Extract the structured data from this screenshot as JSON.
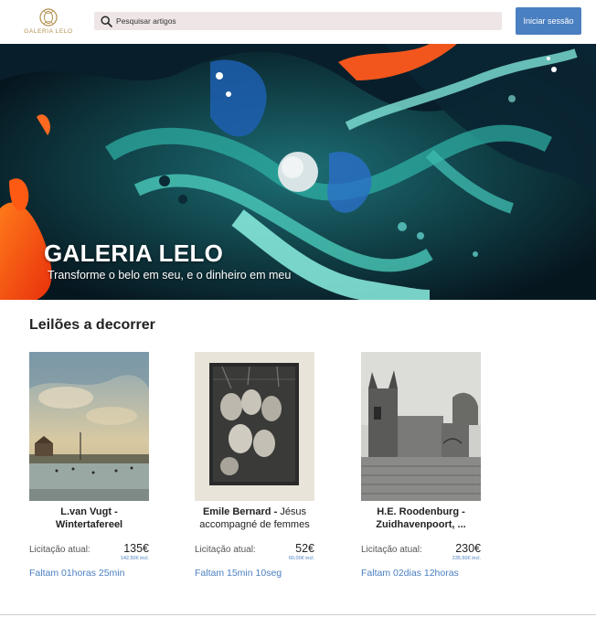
{
  "header": {
    "logo_text": "GALERIA LELO",
    "search_placeholder": "Pesquisar artigos",
    "login_label": "Iniciar sessão"
  },
  "hero": {
    "title": "GALERIA LELO",
    "subtitle": "Transforme o belo em seu, e o dinheiro em meu"
  },
  "auctions": {
    "section_title": "Leilões a decorrer",
    "items": [
      {
        "artist": "L.van Vugt",
        "separator": " - ",
        "title": "Wintertafereel",
        "bid_label": "Licitação atual:",
        "price": "135€",
        "price_incl": "142,50€ incl.",
        "time_left": "Faltam 01horas 25min"
      },
      {
        "artist": "Emile Bernard",
        "separator": " - ",
        "title": "Jésus accompagné de femmes",
        "bid_label": "Licitação atual:",
        "price": "52€",
        "price_incl": "60,00€ incl.",
        "time_left": "Faltam 15min 10seg"
      },
      {
        "artist": "H.E. Roodenburg",
        "separator": "  - ",
        "title": "Zuidhavenpoort, ...",
        "bid_label": "Licitação atual:",
        "price": "230€",
        "price_incl": "235,60€ incl.",
        "time_left": "Faltam 02dias 12horas"
      }
    ]
  },
  "colors": {
    "accent": "#4a7fc1",
    "search_bg": "#eee6e6",
    "logo_gold": "#b08d4a"
  }
}
